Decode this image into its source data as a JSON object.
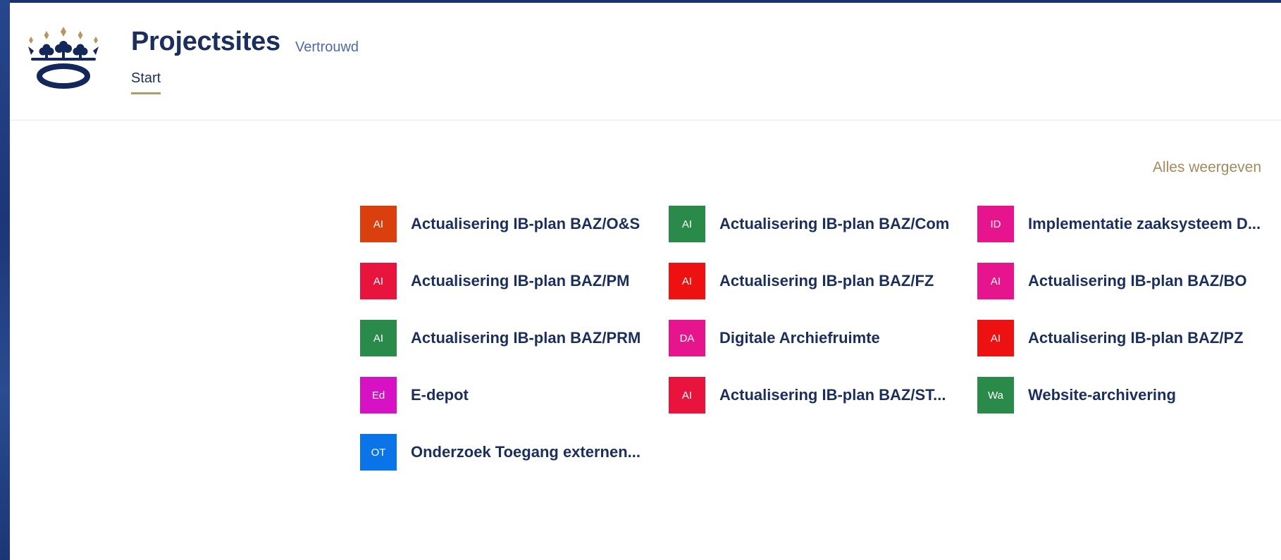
{
  "header": {
    "title": "Projectsites",
    "badge": "Vertrouwd",
    "nav": {
      "start": "Start"
    }
  },
  "sites": {
    "show_all": "Alles weergeven",
    "items": [
      {
        "initials": "AI",
        "label": "Actualisering IB-plan BAZ/O&S",
        "color": "#d9400e"
      },
      {
        "initials": "AI",
        "label": "Actualisering IB-plan BAZ/Com",
        "color": "#2a8a4a"
      },
      {
        "initials": "ID",
        "label": "Implementatie zaaksysteem D...",
        "color": "#e6158d"
      },
      {
        "initials": "AI",
        "label": "Actualisering IB-plan BAZ/PM",
        "color": "#e8143e"
      },
      {
        "initials": "AI",
        "label": "Actualisering IB-plan BAZ/FZ",
        "color": "#ee1112"
      },
      {
        "initials": "AI",
        "label": "Actualisering IB-plan BAZ/BO",
        "color": "#e6158d"
      },
      {
        "initials": "AI",
        "label": "Actualisering IB-plan BAZ/PRM",
        "color": "#2a8a4a"
      },
      {
        "initials": "DA",
        "label": "Digitale Archiefruimte",
        "color": "#e6158d"
      },
      {
        "initials": "AI",
        "label": "Actualisering IB-plan BAZ/PZ",
        "color": "#ee1112"
      },
      {
        "initials": "Ed",
        "label": "E-depot",
        "color": "#d712c5"
      },
      {
        "initials": "AI",
        "label": "Actualisering IB-plan BAZ/ST...",
        "color": "#e8143e"
      },
      {
        "initials": "Wa",
        "label": "Website-archivering",
        "color": "#2a8a4a"
      },
      {
        "initials": "OT",
        "label": "Onderzoek Toegang externen...",
        "color": "#0a74e8"
      }
    ]
  },
  "colors": {
    "brand_navy": "#1b2f5c",
    "accent_gold": "#b09a6a",
    "frame_blue": "#1e3a7a"
  }
}
